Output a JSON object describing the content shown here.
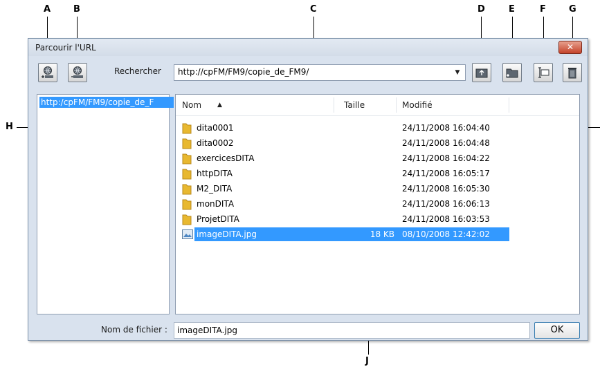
{
  "callouts": {
    "a": "A",
    "b": "B",
    "c": "C",
    "d": "D",
    "e": "E",
    "f": "F",
    "g": "G",
    "h": "H",
    "j": "J"
  },
  "dialog": {
    "title": "Parcourir l'URL",
    "close_label": "✕"
  },
  "toolbar": {
    "search_label": "Rechercher",
    "url_value": "http://cpFM/FM9/copie_de_FM9/"
  },
  "tree": {
    "items": [
      {
        "label": "http:/cpFM/FM9/copie_de_F"
      }
    ]
  },
  "list": {
    "columns": [
      "Nom",
      "Taille",
      "Modifié"
    ],
    "rows": [
      {
        "name": "dita0001",
        "size": "",
        "date": "24/11/2008 16:04:40",
        "type": "folder"
      },
      {
        "name": "dita0002",
        "size": "",
        "date": "24/11/2008 16:04:48",
        "type": "folder"
      },
      {
        "name": "exercicesDITA",
        "size": "",
        "date": "24/11/2008 16:04:22",
        "type": "folder"
      },
      {
        "name": "httpDITA",
        "size": "",
        "date": "24/11/2008 16:05:17",
        "type": "folder"
      },
      {
        "name": "M2_DITA",
        "size": "",
        "date": "24/11/2008 16:05:30",
        "type": "folder"
      },
      {
        "name": "monDITA",
        "size": "",
        "date": "24/11/2008 16:06:13",
        "type": "folder"
      },
      {
        "name": "ProjetDITA",
        "size": "",
        "date": "24/11/2008 16:03:53",
        "type": "folder"
      },
      {
        "name": "imageDITA.jpg",
        "size": "18 KB",
        "date": "08/10/2008 12:42:02",
        "type": "image",
        "selected": true
      }
    ]
  },
  "footer": {
    "filename_label": "Nom de fichier :",
    "filename_value": "imageDITA.jpg",
    "ok_label": "OK"
  },
  "colors": {
    "selection": "#3399ff",
    "dialog_bg": "#d9e2ee",
    "folder": "#e8b830"
  }
}
